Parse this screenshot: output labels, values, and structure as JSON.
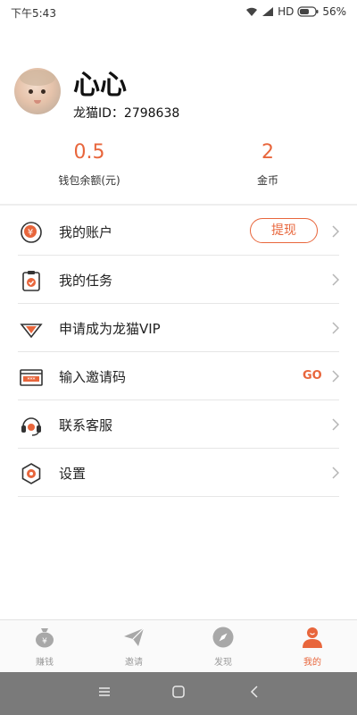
{
  "status": {
    "time": "下午5:43",
    "network": "HD",
    "battery": "56%"
  },
  "profile": {
    "name": "心心",
    "id_text": "龙猫ID：2798638"
  },
  "stats": {
    "wallet": {
      "value": "0.5",
      "label": "钱包余额(元)"
    },
    "coins": {
      "value": "2",
      "label": "金币"
    }
  },
  "menu": {
    "account": {
      "label": "我的账户",
      "action": "提现"
    },
    "tasks": {
      "label": "我的任务"
    },
    "vip": {
      "label": "申请成为龙猫VIP"
    },
    "invite_code": {
      "label": "输入邀请码",
      "action": "GO"
    },
    "support": {
      "label": "联系客服"
    },
    "settings": {
      "label": "设置"
    }
  },
  "bottom_nav": {
    "earn": "赚钱",
    "invite": "邀请",
    "discover": "发现",
    "mine": "我的"
  },
  "colors": {
    "accent": "#e8663c",
    "inactive": "#9a9a9a"
  },
  "icons": {
    "status": [
      "wifi-icon",
      "signal-icon",
      "battery-icon"
    ],
    "menu": [
      "yuan-coin-icon",
      "clipboard-check-icon",
      "vip-diamond-icon",
      "keyboard-code-icon",
      "headset-icon",
      "gear-icon",
      "chevron-right-icon"
    ],
    "nav": [
      "money-bag-icon",
      "paper-plane-icon",
      "compass-icon",
      "person-icon"
    ],
    "system": [
      "menu-icon",
      "home-icon",
      "back-icon"
    ]
  }
}
